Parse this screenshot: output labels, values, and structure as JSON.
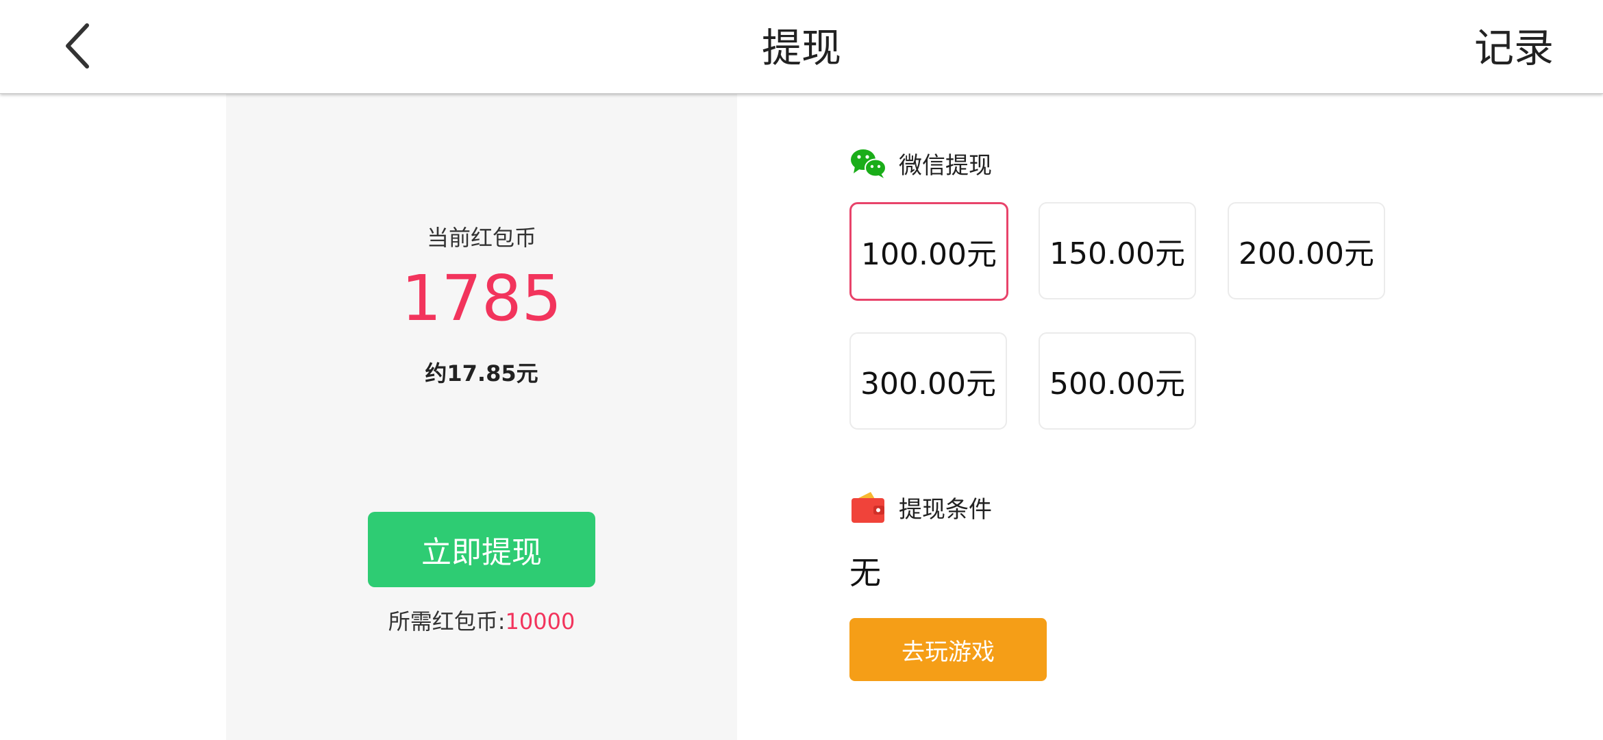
{
  "header": {
    "back_icon": "chevron-left-icon",
    "title": "提现",
    "records_label": "记录"
  },
  "balance": {
    "label": "当前红包币",
    "value": "1785",
    "approx": "约17.85元",
    "withdraw_label": "立即提现",
    "required_label": "所需红包币:",
    "required_value": "10000"
  },
  "wechat": {
    "icon": "wechat-icon",
    "label": "微信提现",
    "amounts": [
      {
        "label": "100.00元",
        "selected": true
      },
      {
        "label": "150.00元",
        "selected": false
      },
      {
        "label": "200.00元",
        "selected": false
      },
      {
        "label": "300.00元",
        "selected": false
      },
      {
        "label": "500.00元",
        "selected": false
      }
    ]
  },
  "conditions": {
    "icon": "wallet-icon",
    "label": "提现条件",
    "value": "无",
    "play_label": "去玩游戏"
  },
  "colors": {
    "accent_red": "#f2345c",
    "selected_border": "#e8436a",
    "withdraw_green": "#2ecc73",
    "play_orange": "#f59e17",
    "wechat_green": "#1aad19",
    "panel_bg": "#f6f6f6"
  }
}
